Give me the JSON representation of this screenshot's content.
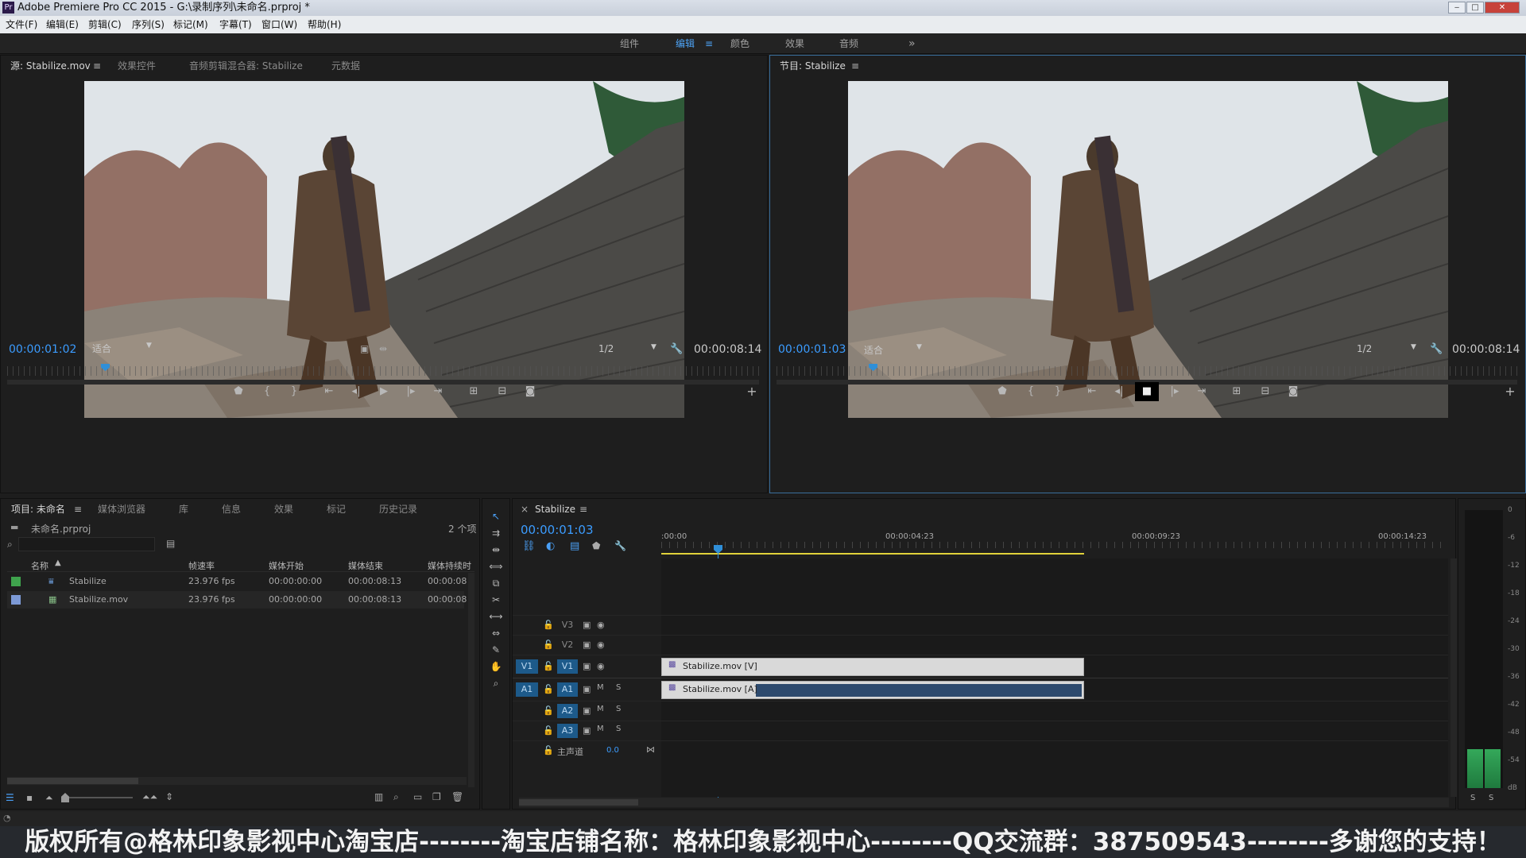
{
  "window": {
    "title": "Adobe Premiere Pro CC 2015 - G:\\录制序列\\未命名.prproj *"
  },
  "menu": [
    "文件(F)",
    "编辑(E)",
    "剪辑(C)",
    "序列(S)",
    "标记(M)",
    "字幕(T)",
    "窗口(W)",
    "帮助(H)"
  ],
  "workspaces": {
    "items": [
      "组件",
      "编辑",
      "颜色",
      "效果",
      "音频"
    ],
    "active": "编辑",
    "more": "»"
  },
  "source_monitor": {
    "tabs": [
      "源: Stabilize.mov",
      "效果控件",
      "音频剪辑混合器: Stabilize",
      "元数据"
    ],
    "timecode": "00:00:01:02",
    "fit": "适合",
    "resolution": "1/2",
    "duration": "00:00:08:14",
    "playhead_fraction": 0.13
  },
  "program_monitor": {
    "tab": "节目: Stabilize",
    "timecode": "00:00:01:03",
    "fit": "适合",
    "resolution": "1/2",
    "duration": "00:00:08:14",
    "playhead_fraction": 0.13
  },
  "project_panel": {
    "tabs": [
      "项目: 未命名",
      "媒体浏览器",
      "库",
      "信息",
      "效果",
      "标记",
      "历史记录"
    ],
    "project_file": "未命名.prproj",
    "item_count": "2 个项",
    "columns": [
      "名称",
      "帧速率",
      "媒体开始",
      "媒体结束",
      "媒体持续时"
    ],
    "rows": [
      {
        "name": "Stabilize",
        "fps": "23.976 fps",
        "start": "00:00:00:00",
        "end": "00:00:08:13",
        "dur": "00:00:08",
        "color": "#3fa34d"
      },
      {
        "name": "Stabilize.mov",
        "fps": "23.976 fps",
        "start": "00:00:00:00",
        "end": "00:00:08:13",
        "dur": "00:00:08",
        "color": "#7d9ad6"
      }
    ]
  },
  "timeline": {
    "tab": "Stabilize",
    "timecode": "00:00:01:03",
    "ruler": [
      ":00:00",
      "00:00:04:23",
      "00:00:09:23",
      "00:00:14:23"
    ],
    "video_tracks": [
      "V3",
      "V2",
      "V1"
    ],
    "audio_tracks": [
      "A1",
      "A2",
      "A3"
    ],
    "source_v": "V1",
    "source_a": "A1",
    "master_label": "主声道",
    "master_value": "0.0",
    "clip_video": "Stabilize.mov [V]",
    "clip_audio": "Stabilize.mov [A]",
    "mute": "M",
    "solo": "S"
  },
  "meter": {
    "scale": [
      "0",
      "-6",
      "-12",
      "-18",
      "-24",
      "-30",
      "-36",
      "-42",
      "-48",
      "-54",
      "dB"
    ],
    "channels": [
      "S",
      "S"
    ],
    "level_fraction": 0.14
  },
  "footer": {
    "text": "版权所有@格林印象影视中心淘宝店--------淘宝店铺名称：格林印象影视中心--------QQ交流群：387509543--------多谢您的支持！"
  },
  "colors": {
    "accent_blue": "#3b9cff",
    "track_blue": "#1d5a8a",
    "playhead": "#2f8fd8",
    "work_area": "#e1d23a"
  }
}
